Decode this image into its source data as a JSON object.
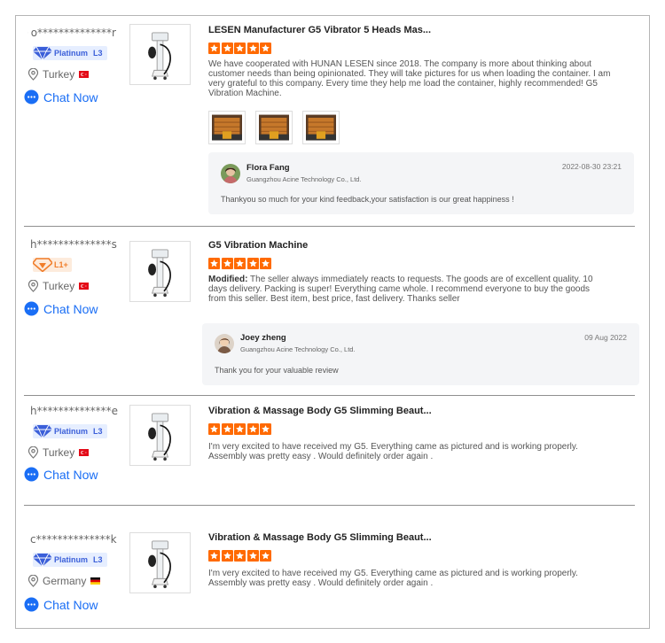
{
  "reviews": [
    {
      "buyer": "o**************r",
      "badge": {
        "tier": "Platinum",
        "level": "L3"
      },
      "country": "Turkey",
      "chat": "Chat Now",
      "title": "LESEN Manufacturer G5 Vibrator 5 Heads Mas...",
      "rating": 5,
      "text": "We have cooperated with HUNAN LESEN since 2018. The company is more about thinking about customer needs than being opinionated. They will take pictures for us when loading the container. I am very grateful to this company. Every time they help me load the container, highly recommended! G5 Vibration Machine.",
      "photos": 3,
      "reply": {
        "name": "Flora Fang",
        "company": "Guangzhou Acine Technology Co., Ltd.",
        "date": "2022-08-30 23:21",
        "text": "Thankyou so much for your kind feedback,your satisfaction is our great happiness !"
      }
    },
    {
      "buyer": "h**************s",
      "badge": {
        "tier": "",
        "level": "L1+"
      },
      "country": "Turkey",
      "chat": "Chat Now",
      "title": "G5 Vibration Machine",
      "rating": 5,
      "modified_label": "Modified:",
      "text": " The seller always immediately reacts to requests. The goods are of excellent quality. 10 days delivery. Packing is super! Everything came whole. I recommend everyone to buy the goods from this seller. Best item, best price, fast delivery. Thanks seller",
      "reply": {
        "name": "Joey zheng",
        "company": "Guangzhou Acine Technology Co., Ltd.",
        "date": "09 Aug 2022",
        "text": "Thank you for your valuable review"
      }
    },
    {
      "buyer": "h**************e",
      "badge": {
        "tier": "Platinum",
        "level": "L3"
      },
      "country": "Turkey",
      "chat": "Chat Now",
      "title": "Vibration & Massage Body G5 Slimming Beaut...",
      "rating": 5,
      "text": "I'm very excited to have received my G5. Everything came as pictured and is working properly. Assembly was pretty easy . Would definitely order again ."
    },
    {
      "buyer": "c**************k",
      "badge": {
        "tier": "Platinum",
        "level": "L3"
      },
      "country": "Germany",
      "chat": "Chat Now",
      "title": "Vibration & Massage Body G5 Slimming Beaut...",
      "rating": 5,
      "text": "I'm very excited to have received my G5. Everything came as pictured and is working properly. Assembly was pretty easy . Would definitely order again ."
    }
  ],
  "colors": {
    "accent": "#1a6ef5",
    "star": "#ff6a00",
    "badge": "#3b5fd9",
    "turkey_flag": "#e30a17"
  }
}
